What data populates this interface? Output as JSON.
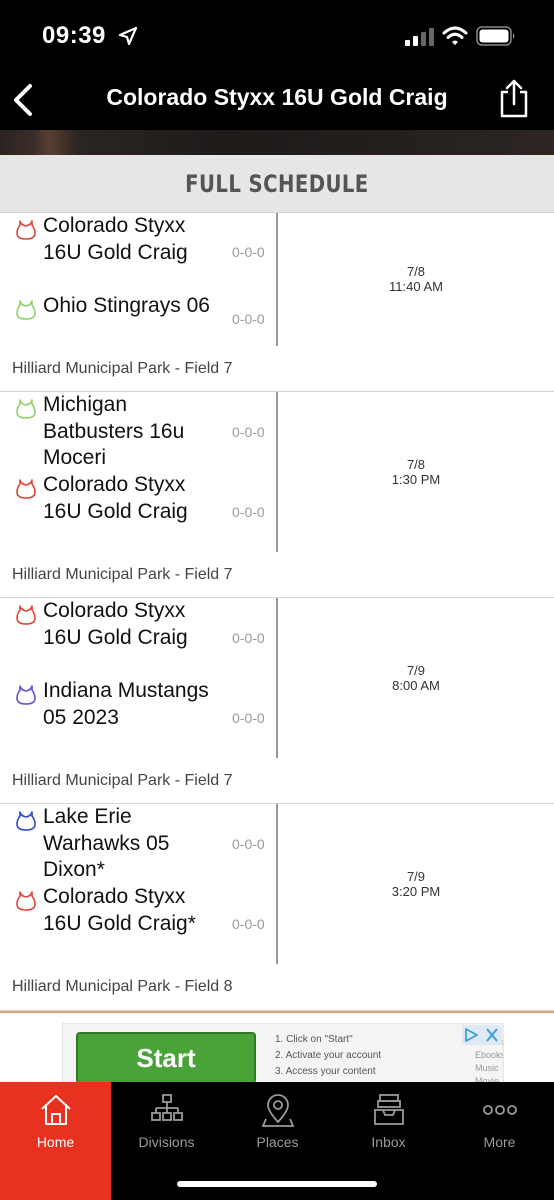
{
  "status_bar": {
    "time": "09:39"
  },
  "nav": {
    "title": "Colorado Styxx 16U Gold Craig"
  },
  "schedule": {
    "title": "FULL SCHEDULE",
    "games": [
      {
        "teams": [
          {
            "name": "Colorado Styxx 16U Gold Craig",
            "record": "0-0-0",
            "color": "#e0453a"
          },
          {
            "name": "Ohio Stingrays 06",
            "record": "0-0-0",
            "color": "#8fd16a"
          }
        ],
        "date": "7/8",
        "time": "11:40 AM",
        "location": "Hilliard Municipal Park - Field 7"
      },
      {
        "teams": [
          {
            "name": "Michigan Batbusters 16u Moceri",
            "record": "0-0-0",
            "color": "#8fd16a"
          },
          {
            "name": "Colorado Styxx 16U Gold Craig",
            "record": "0-0-0",
            "color": "#e0453a"
          }
        ],
        "date": "7/8",
        "time": "1:30 PM",
        "location": "Hilliard Municipal Park - Field 7"
      },
      {
        "teams": [
          {
            "name": "Colorado Styxx 16U Gold Craig",
            "record": "0-0-0",
            "color": "#e0453a"
          },
          {
            "name": "Indiana Mustangs 05 2023",
            "record": "0-0-0",
            "color": "#6b4fd1"
          }
        ],
        "date": "7/9",
        "time": "8:00 AM",
        "location": "Hilliard Municipal Park - Field 7"
      },
      {
        "teams": [
          {
            "name": "Lake Erie Warhawks 05 Dixon*",
            "record": "0-0-0",
            "color": "#2f48c7"
          },
          {
            "name": "Colorado Styxx 16U Gold Craig*",
            "record": "0-0-0",
            "color": "#e0453a"
          }
        ],
        "date": "7/9",
        "time": "3:20 PM",
        "location": "Hilliard Municipal Park - Field 8"
      }
    ]
  },
  "ad": {
    "button_label": "Start",
    "steps": [
      "1. Click on \"Start\"",
      "2. Activate your account",
      "3. Access your content"
    ],
    "categories": [
      "Games",
      "Ebooks",
      "Music",
      "Movie"
    ]
  },
  "tabs": [
    {
      "label": "Home",
      "icon": "home-icon",
      "active": true
    },
    {
      "label": "Divisions",
      "icon": "divisions-icon",
      "active": false
    },
    {
      "label": "Places",
      "icon": "places-icon",
      "active": false
    },
    {
      "label": "Inbox",
      "icon": "inbox-icon",
      "active": false
    },
    {
      "label": "More",
      "icon": "more-icon",
      "active": false
    }
  ],
  "colors": {
    "accent": "#e8321f",
    "header_bg": "#000000",
    "schedule_header_bg": "#e6e6e6"
  }
}
